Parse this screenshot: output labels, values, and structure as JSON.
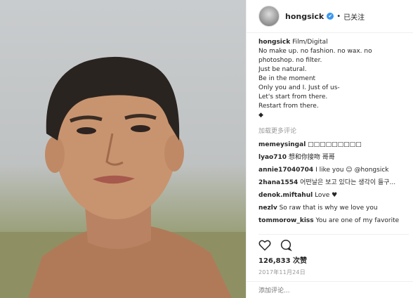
{
  "header": {
    "username": "hongsick",
    "verified_mark": "✔",
    "separator": "•",
    "follow_status": "已关注"
  },
  "caption": {
    "author": "hongsick",
    "lines": [
      "Film/Digital",
      "No make up. no fashion. no wax. no",
      "photoshop. no filter.",
      "Just be natural.",
      "Be in the moment",
      "Only you and I. Just of us-",
      "Let's start from there.",
      "Restart from there.",
      "◆"
    ]
  },
  "load_more": "加载更多评论",
  "comments": [
    {
      "user": "memeysingal",
      "text": "□□□□□□□□□"
    },
    {
      "user": "lyao710",
      "text": "想和你接吻 哥哥"
    },
    {
      "user": "annie17040704",
      "text": "I like you ☺ @hongsick"
    },
    {
      "user": "2hana1554",
      "text": "어떤날은 보고 있다는 생각이 들구..."
    },
    {
      "user": "denok.miftahul",
      "text": "Love ♥"
    },
    {
      "user": "nezlv",
      "text": "So raw that is why we love you"
    },
    {
      "user": "tommorow_kiss",
      "text": "You are one of my favorite"
    }
  ],
  "actions": {
    "like_icon": "heart-outline-icon",
    "comment_icon": "speech-bubble-icon"
  },
  "likes": "126,833 次赞",
  "date": "2017年11月24日",
  "add_comment_placeholder": "添加评论...",
  "colors": {
    "verified_blue": "#3897f0",
    "muted_text": "#999999",
    "primary_text": "#262626"
  }
}
